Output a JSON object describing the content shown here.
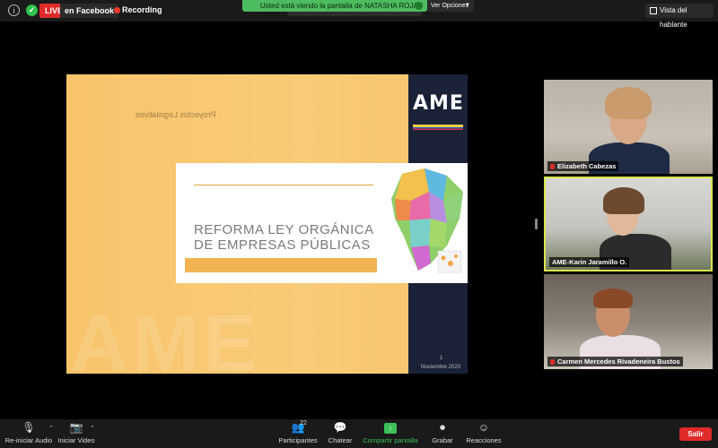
{
  "topbar": {
    "live_label": "LIVE",
    "stream_label": "en Facebook",
    "recording_label": "Recording",
    "share_banner": "Usted está viendo la pantalla de NATASHA ROJAS",
    "view_options": "Ver Opciones",
    "speaker_view": "Vista del hablante"
  },
  "slide": {
    "mirrored_text": "Proyectos Legislativos",
    "logo": "AME",
    "card_title": "REFORMA LEY ORGÁNICA DE EMPRESAS PÚBLICAS",
    "page_number": "1",
    "date": "Noviembre 2020"
  },
  "participants": [
    {
      "name": "Elizabeth Cabezas"
    },
    {
      "name": "AME-Karin Jaramillo O."
    },
    {
      "name": "Carmen Mercedes Rivadeneira Bustos"
    }
  ],
  "toolbar": {
    "audio_label": "Re-iniciar Audio",
    "video_label": "Iniciar Video",
    "participants_label": "Participantes",
    "participants_count": "22",
    "chat_label": "Chatear",
    "share_label": "Compartir pantalla",
    "record_label": "Grabar",
    "reactions_label": "Reacciones",
    "leave_label": "Salir"
  },
  "colors": {
    "live": "#e02a2a",
    "share_green": "#3cc15a",
    "slide_yellow": "#f7c46a",
    "active_speaker": "#d9e64a"
  }
}
